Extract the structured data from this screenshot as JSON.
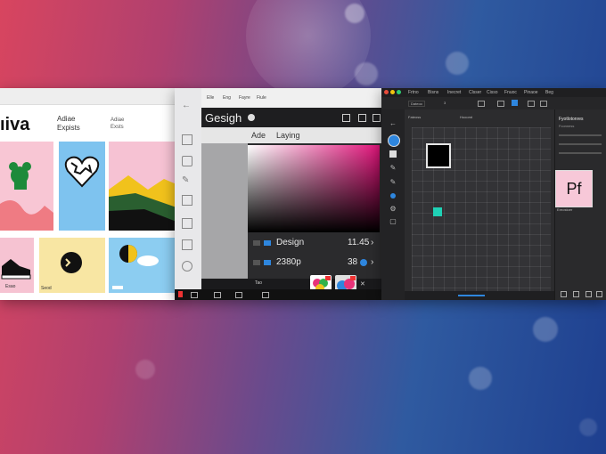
{
  "window1": {
    "brand": "ıiva",
    "subtitle_line1": "Adiae",
    "subtitle_line2": "Expists",
    "subtitle2_line1": "Adiae",
    "subtitle2_line2": "Exsts",
    "tile_label_1": "Esao",
    "tile_label_2": "Seod"
  },
  "window2": {
    "menu": [
      "Elle",
      "Eng",
      "Fayre",
      "Fiule"
    ],
    "title": "Gesigh",
    "tabs": [
      "Ade",
      "Laying"
    ],
    "rows": [
      {
        "label": "Design",
        "value": "11.45"
      },
      {
        "label": "2380p",
        "value": "38"
      }
    ],
    "footer_label": "Tao"
  },
  "window3": {
    "menu": [
      "Frtno",
      "Bisns",
      "Inecret",
      "Clsser",
      "Cisso",
      "Fnuoc",
      "Pinaoe",
      "Beg"
    ],
    "options_label": "Dateoo",
    "options_value": "3",
    "options_label2": "Fateoss",
    "options_label3": "Hooomt",
    "panel_title": "Fyotlotonres",
    "panel_sub": "Fconness",
    "pf_text": "Pf",
    "pf_label": "Ereostoer"
  },
  "colors": {
    "accent_blue": "#2e86de",
    "selection_cyan": "#1fd1b5",
    "pf_pink": "#f7c8d8"
  }
}
